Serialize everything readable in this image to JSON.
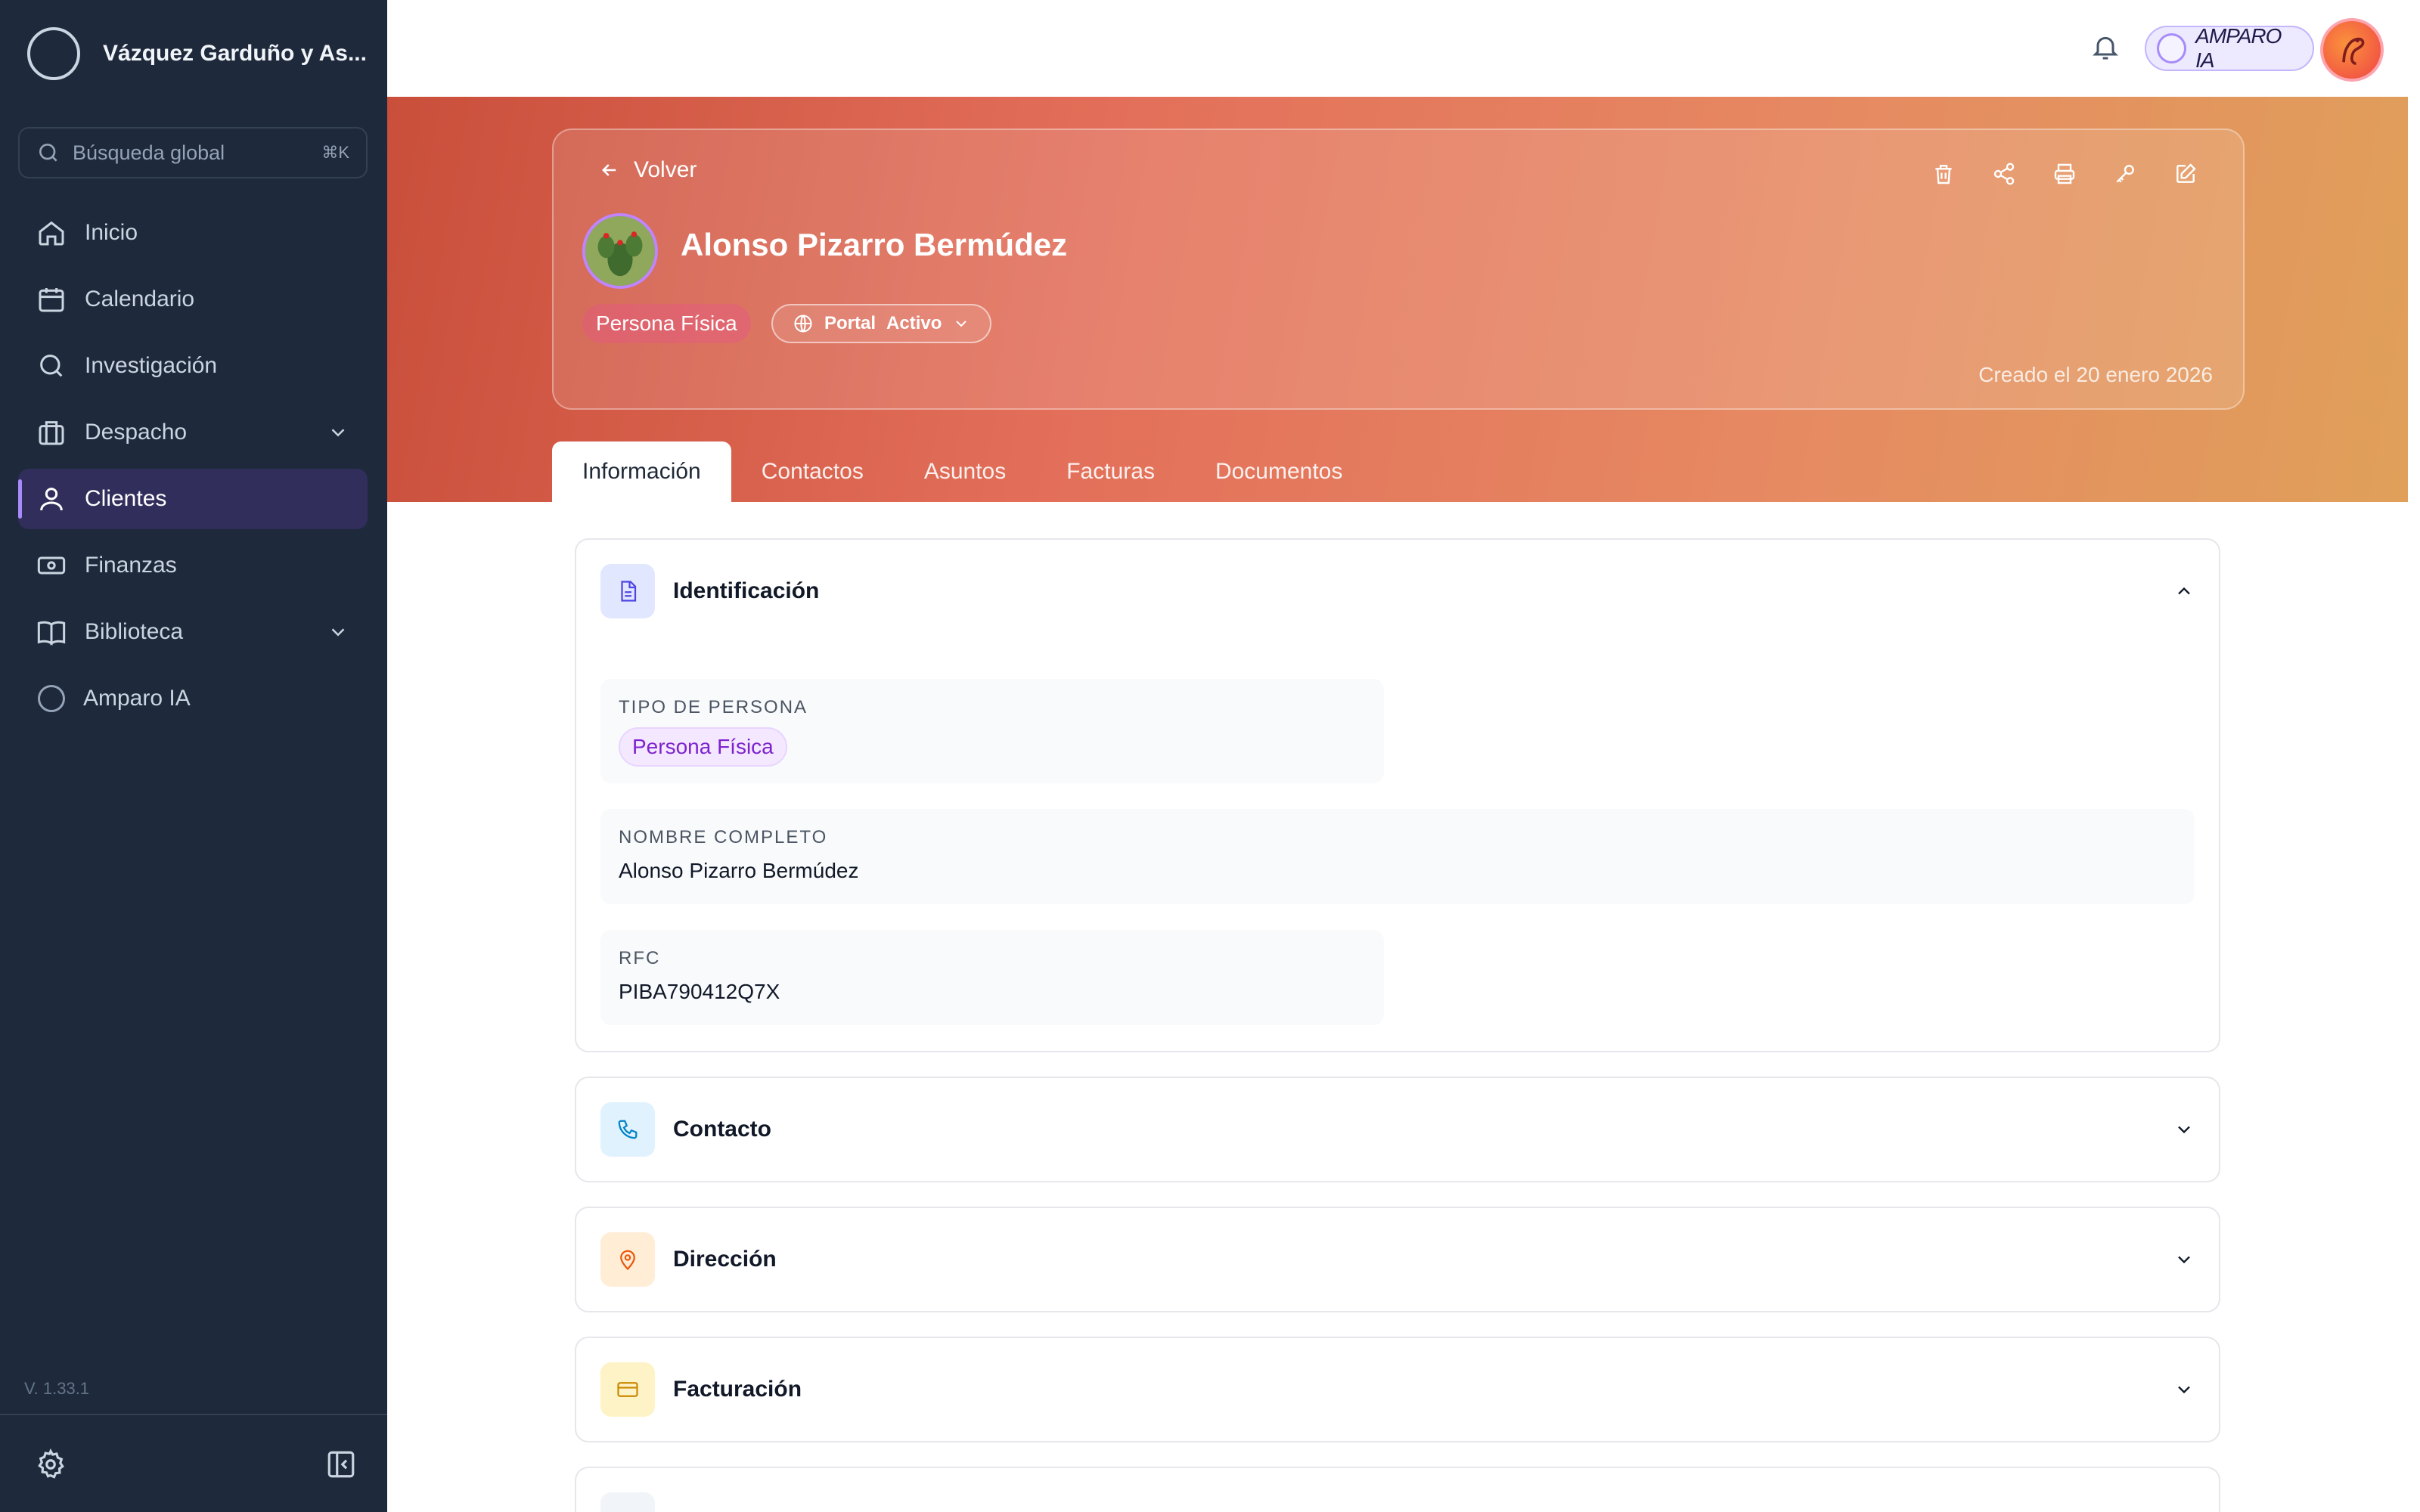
{
  "sidebar": {
    "firm_name": "Vázquez Garduño y As...",
    "search": {
      "placeholder": "Búsqueda global",
      "shortcut": "⌘K"
    },
    "items": [
      {
        "label": "Inicio",
        "icon": "home-icon"
      },
      {
        "label": "Calendario",
        "icon": "calendar-icon"
      },
      {
        "label": "Investigación",
        "icon": "search-icon"
      },
      {
        "label": "Despacho",
        "icon": "briefcase-icon",
        "expandable": true
      },
      {
        "label": "Clientes",
        "icon": "user-icon",
        "active": true
      },
      {
        "label": "Finanzas",
        "icon": "banknote-icon"
      },
      {
        "label": "Biblioteca",
        "icon": "book-icon",
        "expandable": true
      },
      {
        "label": "Amparo IA",
        "icon": "circle-icon"
      }
    ],
    "version": "V. 1.33.1"
  },
  "topbar": {
    "assistant_label": "AMPARO IA"
  },
  "client": {
    "back_label": "Volver",
    "name": "Alonso Pizarro Bermúdez",
    "type_badge": "Persona Física",
    "portal_label": "Portal",
    "portal_status": "Activo",
    "created": "Creado el 20 enero 2026"
  },
  "tabs": [
    "Información",
    "Contactos",
    "Asuntos",
    "Facturas",
    "Documentos"
  ],
  "sections": {
    "identificacion": {
      "title": "Identificación",
      "fields": {
        "tipo_label": "TIPO DE PERSONA",
        "tipo_value": "Persona Física",
        "nombre_label": "NOMBRE COMPLETO",
        "nombre_value": "Alonso Pizarro Bermúdez",
        "rfc_label": "RFC",
        "rfc_value": "PIBA790412Q7X"
      }
    },
    "contacto": {
      "title": "Contacto"
    },
    "direccion": {
      "title": "Dirección"
    },
    "facturacion": {
      "title": "Facturación"
    }
  },
  "colors": {
    "sidebar_bg": "#1e293b",
    "active_item_bg": "#312e5c",
    "accent": "#a78bfa",
    "hero_start": "#c94f3b",
    "hero_end": "#e0a05a"
  }
}
